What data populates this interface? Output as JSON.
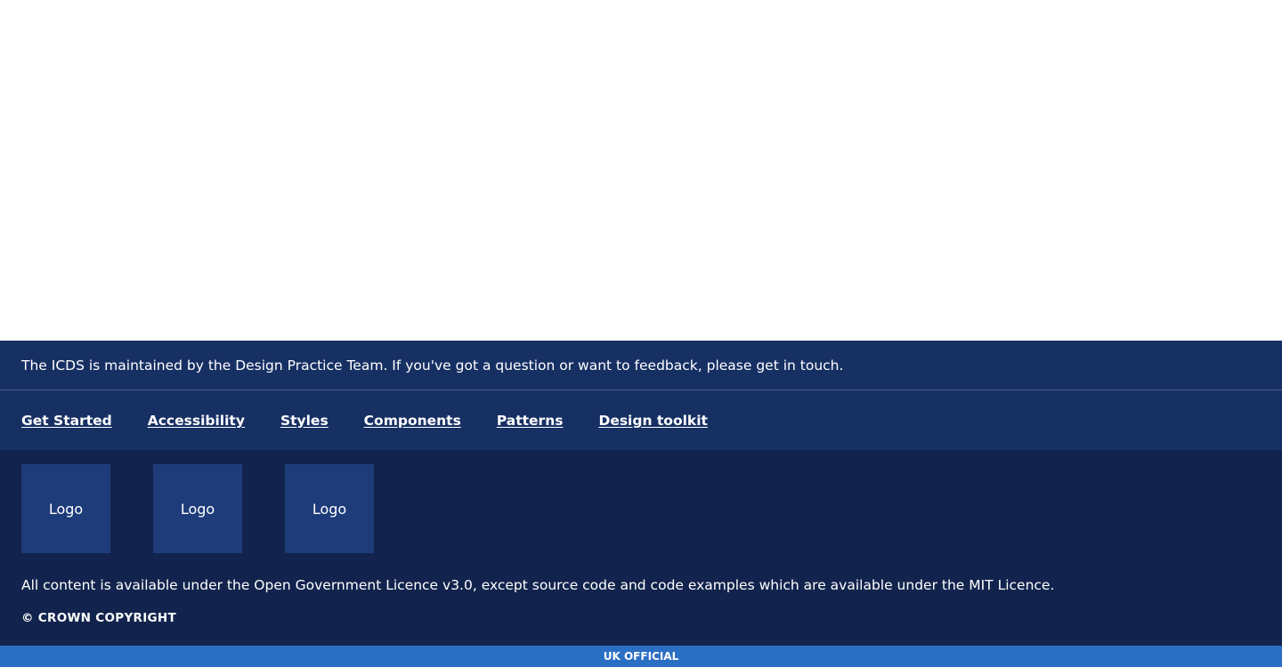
{
  "footer": {
    "message": "The ICDS is maintained by the Design Practice Team. If you've got a question or want to feedback, please get in touch.",
    "nav": [
      {
        "label": "Get Started"
      },
      {
        "label": "Accessibility"
      },
      {
        "label": "Styles"
      },
      {
        "label": "Components"
      },
      {
        "label": "Patterns"
      },
      {
        "label": "Design toolkit"
      }
    ],
    "logos": [
      {
        "label": "Logo"
      },
      {
        "label": "Logo"
      },
      {
        "label": "Logo"
      }
    ],
    "licence": "All content is available under the Open Government Licence v3.0, except source code and code examples which are available under the MIT Licence.",
    "copyright": "© CROWN COPYRIGHT"
  },
  "classification_banner": {
    "label": "UK OFFICIAL"
  },
  "colors": {
    "footer_top": "#173064",
    "footer_bottom": "#12244d",
    "logo_tile": "#1e3c7a",
    "classification": "#2b6fc4"
  }
}
